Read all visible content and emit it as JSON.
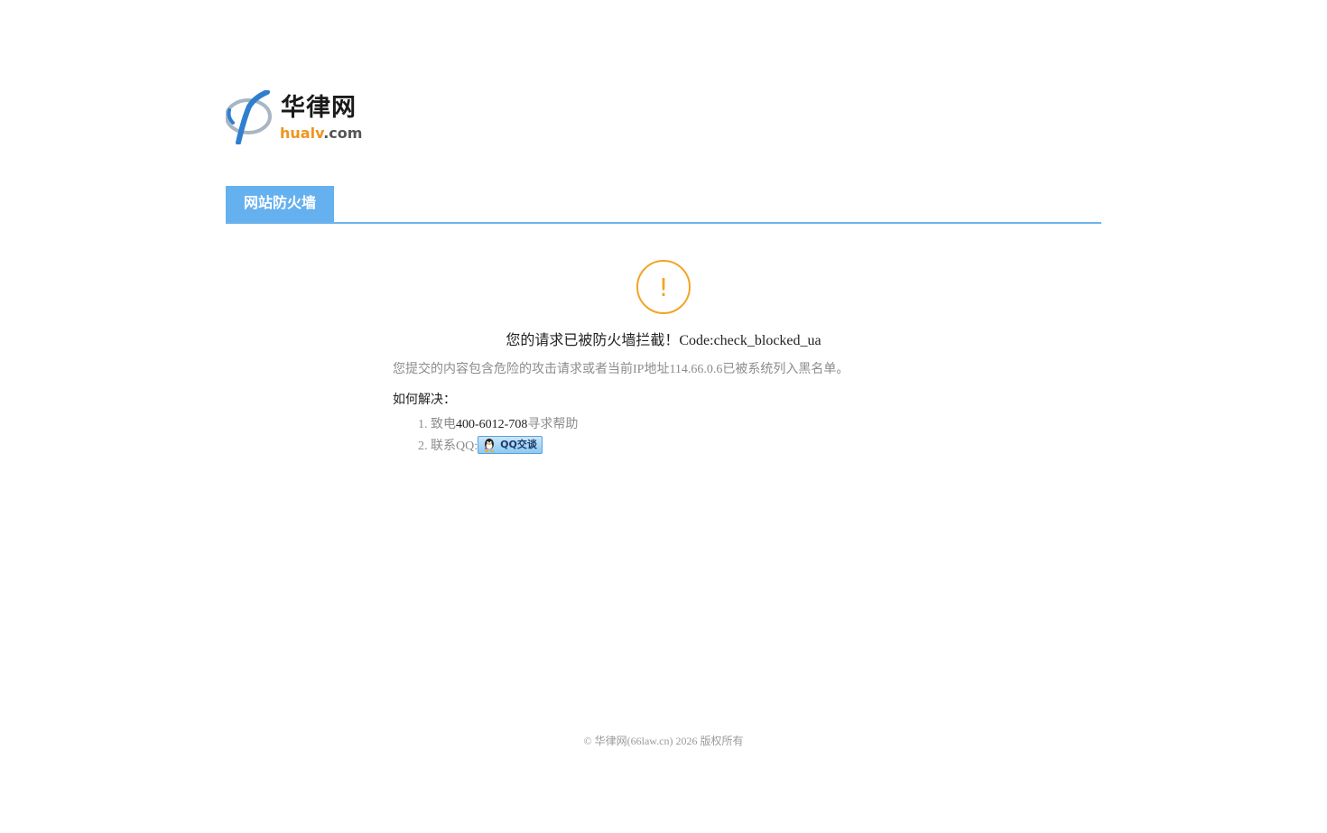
{
  "logo": {
    "name_cn": "华律网",
    "domain_main": "hualv",
    "domain_suffix": ".com"
  },
  "tab": {
    "label": "网站防火墙"
  },
  "warning": {
    "icon": "!",
    "headline": "您的请求已被防火墙拦截！Code:check_blocked_ua",
    "description": "您提交的内容包含危险的攻击请求或者当前IP地址114.66.0.6已被系统列入黑名单。"
  },
  "howto": {
    "title": "如何解决：",
    "step1_prefix": "1. 致电",
    "step1_phone": "400-6012-708",
    "step1_suffix": "寻求帮助",
    "step2_prefix": "2. 联系QQ:",
    "qq_button_label": "QQ交谈"
  },
  "footer": {
    "text": "© 华律网(66law.cn) 2026 版权所有"
  },
  "colors": {
    "tab_bg": "#65b0ef",
    "tab_line": "#6cb3ec",
    "warn": "#f3a424",
    "logo_orange": "#f0941d",
    "logo_blue": "#2f7fd0"
  },
  "icons": {
    "logo": "hualv-logo-icon",
    "warning": "exclamation-circle-icon",
    "qq": "qq-penguin-icon"
  }
}
